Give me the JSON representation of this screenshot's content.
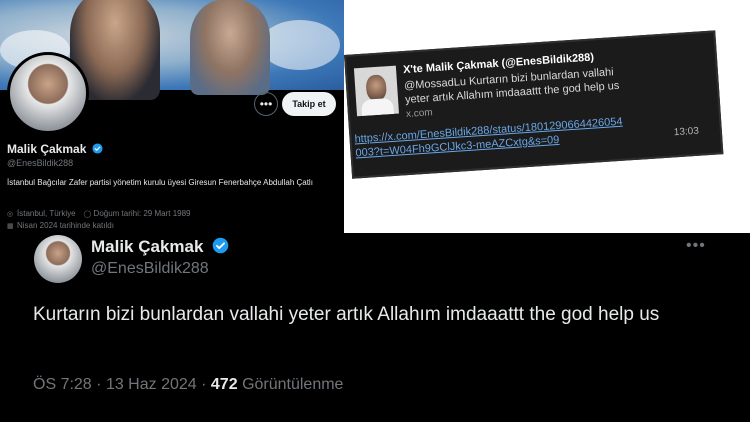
{
  "profile": {
    "name": "Malik Çakmak",
    "handle": "@EnesBildik288",
    "follow_label": "Takip et",
    "more_label": "•••",
    "bio": "İstanbul Bağcılar Zafer partisi yönetim kurulu üyesi Giresun Fenerbahçe Abdullah Çatlı",
    "location": "İstanbul, Türkiye",
    "birthdate": "Doğum tarihi: 29 Mart 1989",
    "joined": "Nisan 2024 tarihinde katıldı",
    "icons": {
      "location": "location-pin-icon",
      "birthday": "balloon-icon",
      "joined": "calendar-icon"
    }
  },
  "preview": {
    "title": "X'te Malik Çakmak (@EnesBildik288)",
    "description": "@MossadLu Kurtarın bizi bunlardan vallahi yeter artık Allahım imdaaattt the god help us",
    "domain": "x.com",
    "link": "https://x.com/EnesBildik288/status/1801290664426054003?t=W04Fh9GClJkc3-meAZCxtg&s=09",
    "time": "13:03"
  },
  "tweet": {
    "name": "Malik Çakmak",
    "handle": "@EnesBildik288",
    "more_label": "•••",
    "text": "Kurtarın bizi bunlardan vallahi yeter artık Allahım imdaaattt the god help us",
    "time": "ÖS 7:28",
    "sep": "·",
    "date": "13 Haz 2024",
    "sep2": "·",
    "views": "472",
    "views_label": "Görüntülenme"
  },
  "colors": {
    "verified": "#1d9bf0",
    "background": "#000000",
    "link": "#6aa7e8"
  }
}
